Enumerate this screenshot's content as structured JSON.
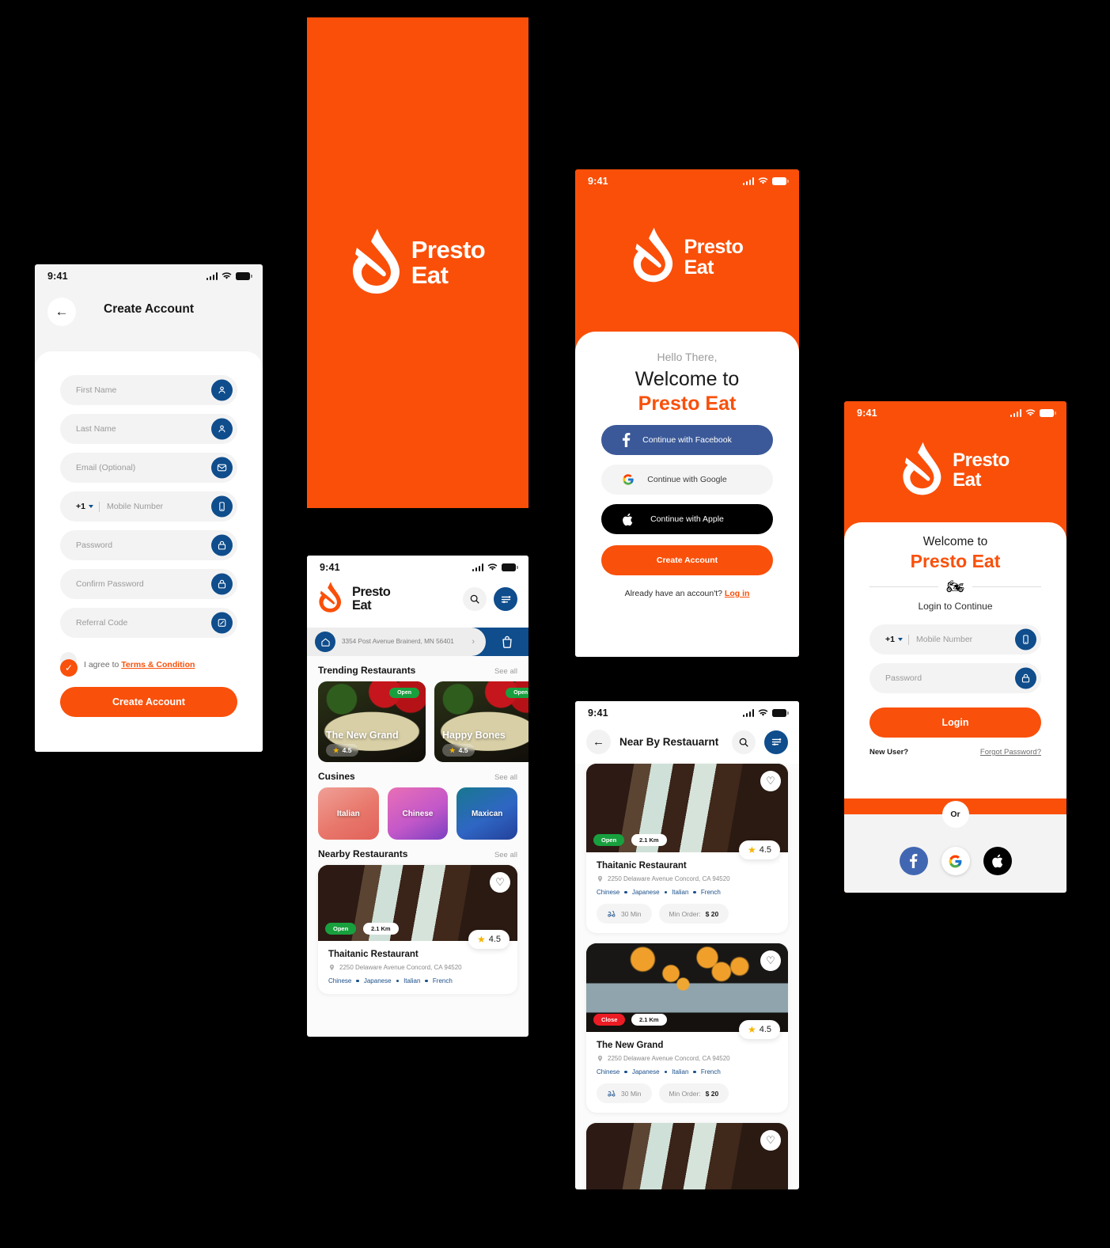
{
  "meta": {
    "status_time": "9:41",
    "brand_orange": "#fa4f09",
    "brand_blue": "#0f4d8c",
    "green": "#18a03e",
    "red": "#ec1c24"
  },
  "brand": {
    "line1": "Presto",
    "line2": "Eat",
    "full": "Presto Eat"
  },
  "create_account": {
    "title": "Create Account",
    "fields": [
      {
        "placeholder": "First Name",
        "icon": "user-icon"
      },
      {
        "placeholder": "Last Name",
        "icon": "user-icon"
      },
      {
        "placeholder": "Email (Optional)",
        "icon": "mail-icon"
      },
      {
        "placeholder": "Mobile Number",
        "icon": "phone-icon",
        "country_code": "+1"
      },
      {
        "placeholder": "Password",
        "icon": "lock-icon"
      },
      {
        "placeholder": "Confirm Password",
        "icon": "lock-icon"
      },
      {
        "placeholder": "Referral Code",
        "icon": "gift-icon"
      }
    ],
    "agree_prefix": "I agree to ",
    "terms_link": "Terms & Condition",
    "submit_label": "Create Account"
  },
  "welcome": {
    "hello": "Hello There,",
    "welcome_to": "Welcome to",
    "brand": "Presto Eat",
    "buttons": [
      {
        "label": "Continue with Facebook",
        "provider": "facebook"
      },
      {
        "label": "Continue with Google",
        "provider": "google"
      },
      {
        "label": "Continue with Apple",
        "provider": "apple"
      }
    ],
    "create_account_label": "Create Account",
    "footer_text": "Already have an accoun't? ",
    "footer_link": "Log in"
  },
  "login": {
    "welcome_to": "Welcome to",
    "brand": "Presto Eat",
    "subtitle": "Login to Continue",
    "scooter_icon": "delivery-scooter-icon",
    "mobile": {
      "country_code": "+1",
      "placeholder": "Mobile Number",
      "icon": "phone-icon"
    },
    "password": {
      "placeholder": "Password",
      "icon": "lock-icon"
    },
    "submit_label": "Login",
    "new_user": "New User?",
    "forgot": "Forgot Password?",
    "or": "Or",
    "socials": [
      "facebook",
      "google",
      "apple"
    ]
  },
  "home": {
    "address": "3354 Post Avenue Brainerd, MN 56401",
    "sections": [
      {
        "title": "Trending Restaurants",
        "link": "See all"
      },
      {
        "title": "Cusines",
        "link": "See all"
      },
      {
        "title": "Nearby Restaurants",
        "link": "See all"
      }
    ],
    "trending": [
      {
        "name": "The New Grand",
        "status": "Open",
        "rating": "4.5"
      },
      {
        "name": "Happy Bones",
        "status": "Open",
        "rating": "4.5"
      }
    ],
    "cuisines": [
      {
        "label": "Italian"
      },
      {
        "label": "Chinese"
      },
      {
        "label": "Maxican"
      }
    ],
    "nearby": {
      "name": "Thaitanic Restaurant",
      "address": "2250 Delaware Avenue Concord, CA 94520",
      "status": "Open",
      "distance": "2.1 Km",
      "rating": "4.5",
      "tags": [
        "Chinese",
        "Japanese",
        "Italian",
        "French"
      ]
    }
  },
  "nearby_page": {
    "title": "Near By Restauarnt",
    "cards": [
      {
        "name": "Thaitanic Restaurant",
        "address": "2250 Delaware Avenue Concord, CA 94520",
        "status": "Open",
        "distance": "2.1 Km",
        "rating": "4.5",
        "tags": [
          "Chinese",
          "Japanese",
          "Italian",
          "French"
        ],
        "time": "30 Min",
        "min_order_label": "Min Order:",
        "min_order_value": "$ 20"
      },
      {
        "name": "The New Grand",
        "address": "2250 Delaware Avenue Concord, CA 94520",
        "status": "Close",
        "distance": "2.1 Km",
        "rating": "4.5",
        "tags": [
          "Chinese",
          "Japanese",
          "Italian",
          "French"
        ],
        "time": "30 Min",
        "min_order_label": "Min Order:",
        "min_order_value": "$ 20"
      }
    ]
  }
}
